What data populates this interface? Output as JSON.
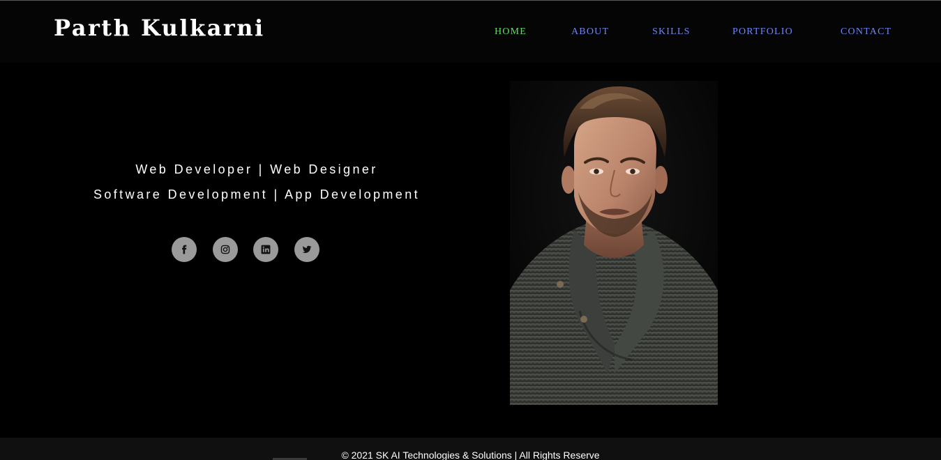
{
  "header": {
    "brand": "Parth Kulkarni",
    "nav": [
      "HOME",
      "ABOUT",
      "SKILLS",
      "PORTFOLIO",
      "CONTACT"
    ],
    "active_index": 0
  },
  "hero": {
    "line1": "Web Developer | Web Designer",
    "line2": "Software Development | App Development",
    "social_icons": [
      "facebook-icon",
      "instagram-icon",
      "linkedin-icon",
      "twitter-icon"
    ]
  },
  "footer": {
    "text": "© 2021 SK AI Technologies & Solutions | All Rights Reserve"
  },
  "colors": {
    "background": "#000000",
    "nav_link": "#6e86f2",
    "nav_active": "#59e35e",
    "social_bg": "#9a9a9a",
    "footer_bg": "#101010"
  }
}
